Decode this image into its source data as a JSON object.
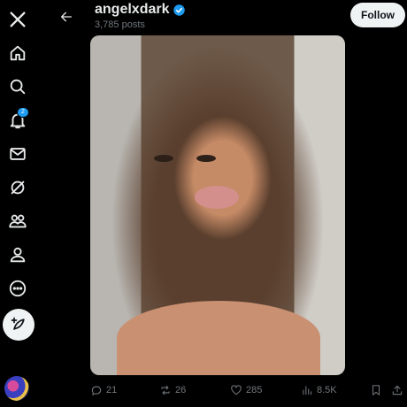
{
  "sidebar": {
    "items": [
      {
        "icon": "x-logo-icon"
      },
      {
        "icon": "home-icon"
      },
      {
        "icon": "search-icon"
      },
      {
        "icon": "notifications-icon",
        "badge": "2"
      },
      {
        "icon": "messages-icon"
      },
      {
        "icon": "grok-icon"
      },
      {
        "icon": "communities-icon"
      },
      {
        "icon": "profile-icon"
      },
      {
        "icon": "more-icon"
      }
    ],
    "post_button_icon": "compose-icon",
    "avatar_icon": "avatar"
  },
  "header": {
    "name": "angelxdark",
    "verified": true,
    "posts_count": "3,785 posts",
    "follow_label": "Follow"
  },
  "media": {
    "description_icon": "photo"
  },
  "actions": {
    "replies": "21",
    "reposts": "26",
    "likes": "285",
    "views": "8.5K"
  },
  "colors": {
    "background": "#000000",
    "accent": "#1d9bf0",
    "text_primary": "#e7e9ea",
    "text_secondary": "#71767b"
  }
}
